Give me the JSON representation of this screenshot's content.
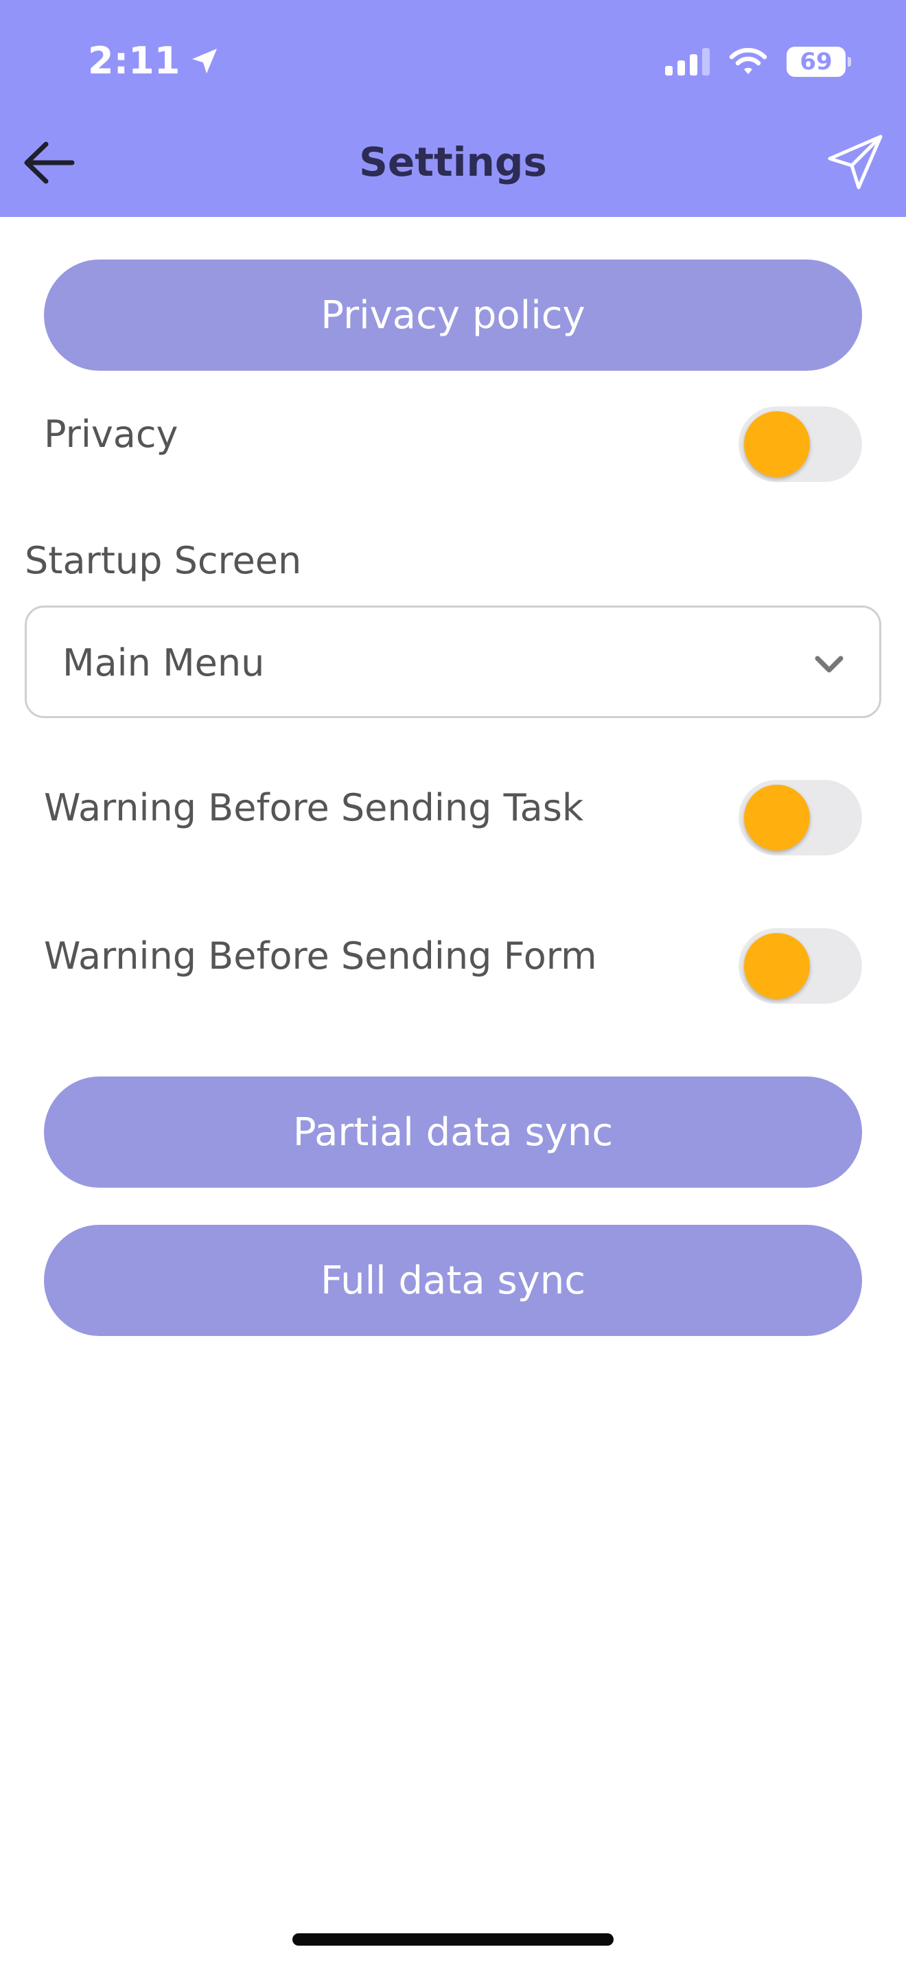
{
  "status_bar": {
    "time": "2:11",
    "battery_level": "69"
  },
  "nav": {
    "title": "Settings",
    "back_icon": "arrow-left-icon",
    "send_icon": "paper-plane-icon"
  },
  "buttons": {
    "privacy_policy": "Privacy policy",
    "partial_sync": "Partial data sync",
    "full_sync": "Full data sync"
  },
  "settings": {
    "privacy": {
      "label": "Privacy",
      "on": false
    },
    "startup_screen": {
      "label": "Startup Screen",
      "value": "Main Menu"
    },
    "warning_task": {
      "label": "Warning Before Sending Task",
      "on": false
    },
    "warning_form": {
      "label": "Warning Before Sending Form",
      "on": false
    }
  },
  "colors": {
    "header": "#9394fa",
    "button": "#9898e0",
    "toggle_knob": "#ffb00f",
    "toggle_track": "#e9e9ec",
    "title": "#2c2c54",
    "text": "#555555"
  }
}
